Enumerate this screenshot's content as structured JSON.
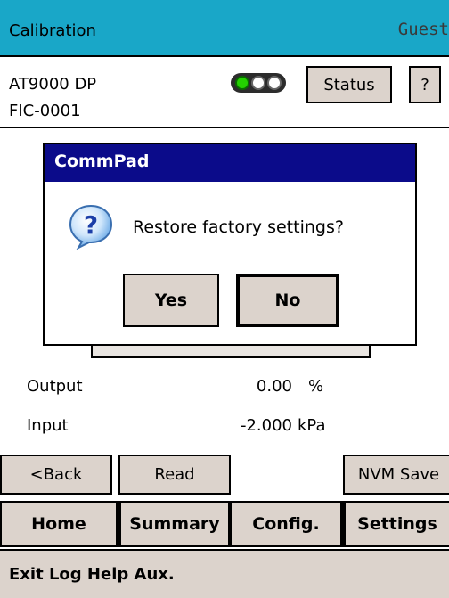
{
  "titlebar": {
    "title": "Calibration",
    "user": "Guest"
  },
  "device": {
    "model": "AT9000 DP",
    "tag": "FIC-0001",
    "status_button": "Status",
    "help_button": "?"
  },
  "status_lights": {
    "states": [
      "on",
      "off",
      "off"
    ],
    "on_color": "#24d100"
  },
  "readings": {
    "output": {
      "label": "Output",
      "value": "0.00",
      "unit": "%"
    },
    "input": {
      "label": "Input",
      "value": "-2.000",
      "unit": "kPa"
    }
  },
  "actions": {
    "back": "<Back",
    "read": "Read",
    "nvm_save": "NVM Save"
  },
  "tabs": {
    "home": "Home",
    "summary": "Summary",
    "config": "Config.",
    "settings": "Settings"
  },
  "menu": {
    "items": "Exit Log Help Aux."
  },
  "dialog": {
    "title": "CommPad",
    "icon": "question-icon",
    "message": "Restore factory settings?",
    "yes": "Yes",
    "no": "No"
  },
  "colors": {
    "titlebar": "#19a7c8",
    "dialog_title": "#0b0b8a",
    "button_face": "#dcd3cc"
  }
}
